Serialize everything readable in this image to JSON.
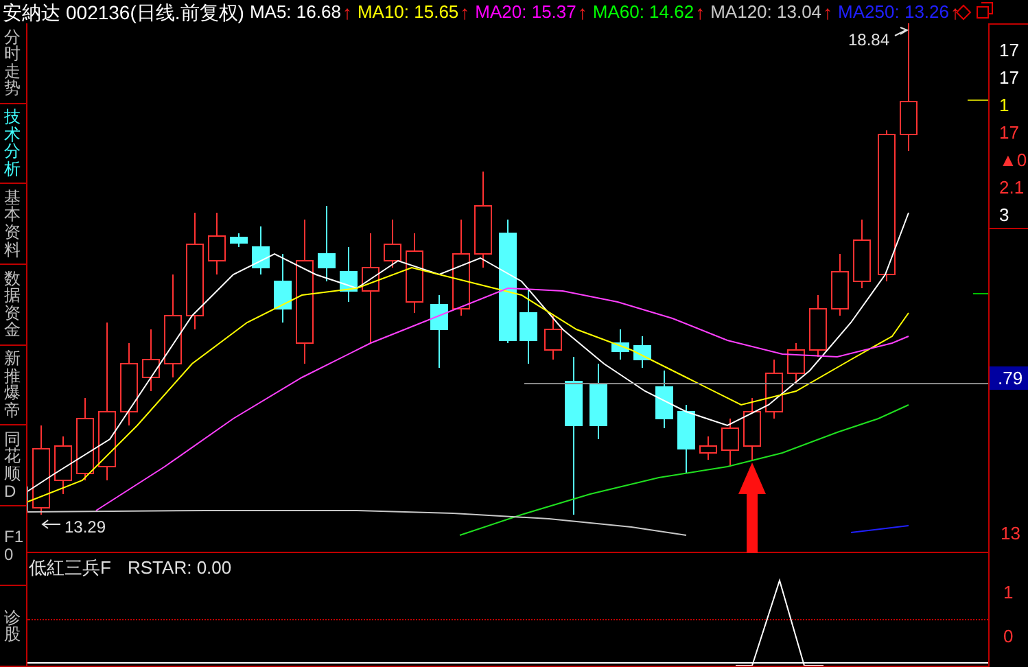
{
  "header": {
    "stock_name": "安納达",
    "code": "002136",
    "period": "(日线.前复权)",
    "moving_averages": [
      {
        "label": "MA5:",
        "value": "16.68",
        "trend": "↑",
        "color": "#ffffff"
      },
      {
        "label": "MA10:",
        "value": "15.65",
        "trend": "↑",
        "color": "#ffff00"
      },
      {
        "label": "MA20:",
        "value": "15.37",
        "trend": "↑",
        "color": "#ff00ff"
      },
      {
        "label": "MA60:",
        "value": "14.62",
        "trend": "↑",
        "color": "#00ff00"
      },
      {
        "label": "MA120:",
        "value": "13.04",
        "trend": "↑",
        "color": "#c8c8c8"
      },
      {
        "label": "MA250:",
        "value": "13.26",
        "trend": "↑",
        "color": "#2020ff"
      }
    ]
  },
  "side_tabs": [
    {
      "label": "分时走势",
      "selected": false
    },
    {
      "label": "技术分析",
      "selected": true
    },
    {
      "label": "基本资料",
      "selected": false
    },
    {
      "label": "数据资金",
      "selected": false
    },
    {
      "label": "新推爆帝",
      "selected": false
    },
    {
      "label": "同花顺D",
      "selected": false
    },
    {
      "label": "F10",
      "selected": false
    },
    {
      "label": "诊股",
      "selected": false
    }
  ],
  "main_chart": {
    "high_label": "18.84",
    "low_label": "13.29",
    "current_price_tag": ".79"
  },
  "right_axis": [
    {
      "text": "17",
      "color": "#ffffff"
    },
    {
      "text": "17",
      "color": "#ffffff"
    },
    {
      "text": "1",
      "color": "#ffff00"
    },
    {
      "text": "17",
      "color": "#ff3030"
    },
    {
      "text": "▲0",
      "color": "#ff3030"
    },
    {
      "text": "2.1",
      "color": "#ff3030"
    },
    {
      "text": "3",
      "color": "#ffffff"
    }
  ],
  "price_scale": [
    {
      "text": "13"
    }
  ],
  "indicator": {
    "name": "低紅三兵F",
    "reading": "RSTAR: 0.00",
    "scale": [
      {
        "text": "1"
      },
      {
        "text": "0"
      }
    ]
  }
}
